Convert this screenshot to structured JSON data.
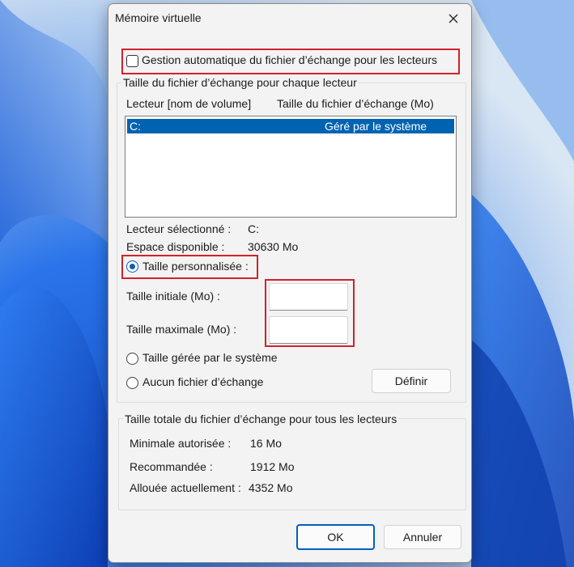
{
  "dialog": {
    "title": "Mémoire virtuelle",
    "auto_manage_label": "Gestion automatique du fichier d’échange pour les lecteurs",
    "per_drive_group": {
      "label": "Taille du fichier d’échange pour chaque lecteur",
      "columns": [
        "Lecteur [nom de volume]",
        "Taille du fichier d’échange (Mo)"
      ],
      "rows": [
        {
          "drive": "C:",
          "size": "Géré par le système"
        }
      ],
      "selected_drive_label": "Lecteur sélectionné :",
      "selected_drive_value": "C:",
      "free_space_label": "Espace disponible :",
      "free_space_value": "30630 Mo",
      "custom_size_label": "Taille personnalisée :",
      "initial_size_label": "Taille initiale (Mo) :",
      "initial_size_value": "",
      "max_size_label": "Taille maximale (Mo) :",
      "max_size_value": "",
      "system_managed_label": "Taille gérée par le système",
      "no_paging_label": "Aucun fichier d’échange",
      "set_button": "Définir"
    },
    "total_group": {
      "label": "Taille totale du fichier d’échange pour tous les lecteurs",
      "min_label": "Minimale autorisée :",
      "min_value": "16 Mo",
      "recommended_label": "Recommandée :",
      "recommended_value": "1912 Mo",
      "current_label": "Allouée actuellement :",
      "current_value": "4352 Mo"
    },
    "ok_button": "OK",
    "cancel_button": "Annuler",
    "auto_manage_checked": false,
    "selected_option": "custom"
  },
  "colors": {
    "accent": "#0063b1",
    "highlight": "#d0232a"
  }
}
